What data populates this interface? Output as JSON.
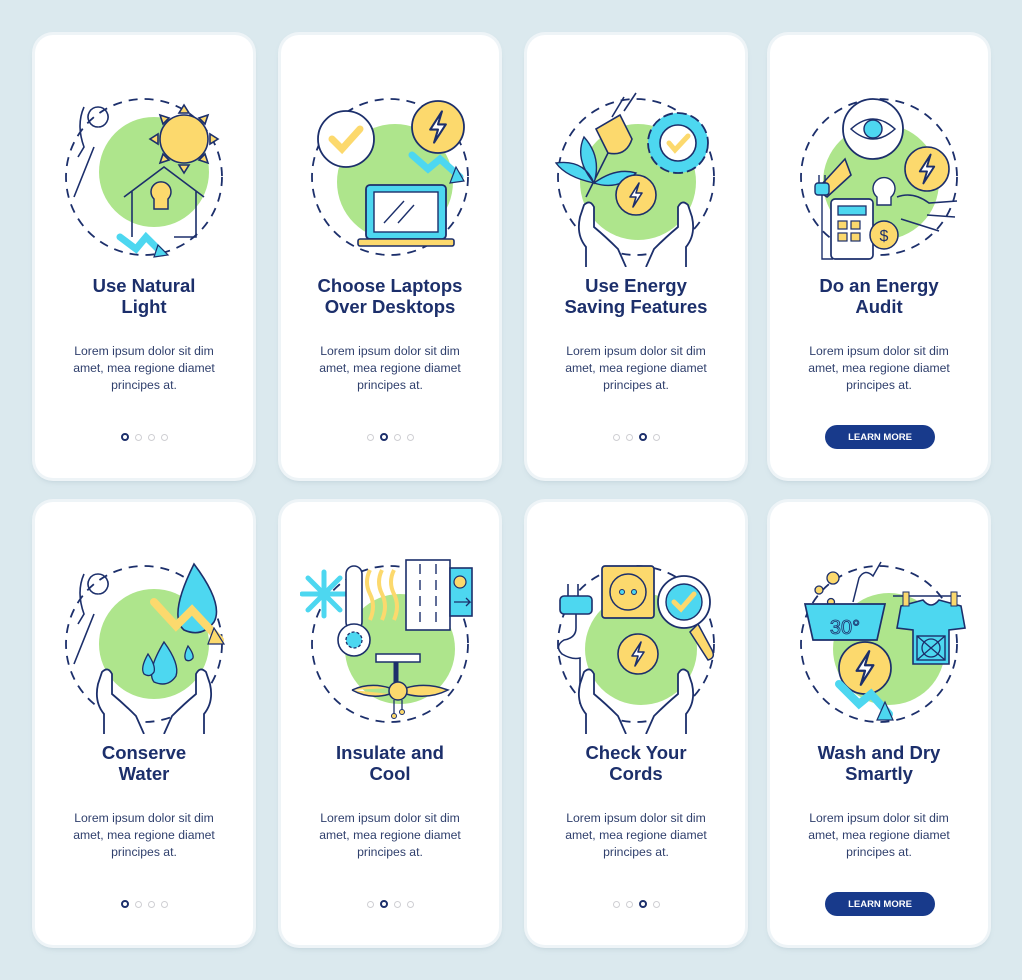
{
  "colors": {
    "background": "#dbe9ee",
    "card": "#ffffff",
    "title": "#1c2f6b",
    "body_text": "#2f3f6c",
    "button": "#183a8b",
    "accent_green": "#aee58c",
    "accent_yellow": "#fcd96d",
    "accent_cyan": "#4dd7f0",
    "outline": "#1c2f6b"
  },
  "cards": [
    {
      "title_line1": "Use Natural",
      "title_line2": "Light",
      "desc_line1": "Lorem ipsum dolor sit dim",
      "desc_line2": "amet, mea regione diamet",
      "desc_line3": "principes at.",
      "icon": "natural-light-icon",
      "active_dot": 1
    },
    {
      "title_line1": "Choose Laptops",
      "title_line2": "Over Desktops",
      "desc_line1": "Lorem ipsum dolor sit dim",
      "desc_line2": "amet, mea regione diamet",
      "desc_line3": "principes at.",
      "icon": "laptop-icon",
      "active_dot": 2
    },
    {
      "title_line1": "Use Energy",
      "title_line2": "Saving Features",
      "desc_line1": "Lorem ipsum dolor sit dim",
      "desc_line2": "amet, mea regione diamet",
      "desc_line3": "principes at.",
      "icon": "energy-saving-icon",
      "active_dot": 3
    },
    {
      "title_line1": "Do an Energy",
      "title_line2": "Audit",
      "desc_line1": "Lorem ipsum dolor sit dim",
      "desc_line2": "amet, mea regione diamet",
      "desc_line3": "principes at.",
      "icon": "energy-audit-icon",
      "button_label": "LEARN MORE"
    },
    {
      "title_line1": "Conserve",
      "title_line2": "Water",
      "desc_line1": "Lorem ipsum dolor sit dim",
      "desc_line2": "amet, mea regione diamet",
      "desc_line3": "principes at.",
      "icon": "water-drop-icon",
      "active_dot": 1
    },
    {
      "title_line1": "Insulate and",
      "title_line2": "Cool",
      "desc_line1": "Lorem ipsum dolor sit dim",
      "desc_line2": "amet, mea regione diamet",
      "desc_line3": "principes at.",
      "icon": "insulate-cool-icon",
      "active_dot": 2
    },
    {
      "title_line1": "Check Your",
      "title_line2": "Cords",
      "desc_line1": "Lorem ipsum dolor sit dim",
      "desc_line2": "amet, mea regione diamet",
      "desc_line3": "principes at.",
      "icon": "power-cord-icon",
      "active_dot": 3
    },
    {
      "title_line1": "Wash and Dry",
      "title_line2": "Smartly",
      "desc_line1": "Lorem ipsum dolor sit dim",
      "desc_line2": "amet, mea regione diamet",
      "desc_line3": "principes at.",
      "icon": "laundry-icon",
      "button_label": "LEARN MORE",
      "temp_label": "30°"
    }
  ]
}
